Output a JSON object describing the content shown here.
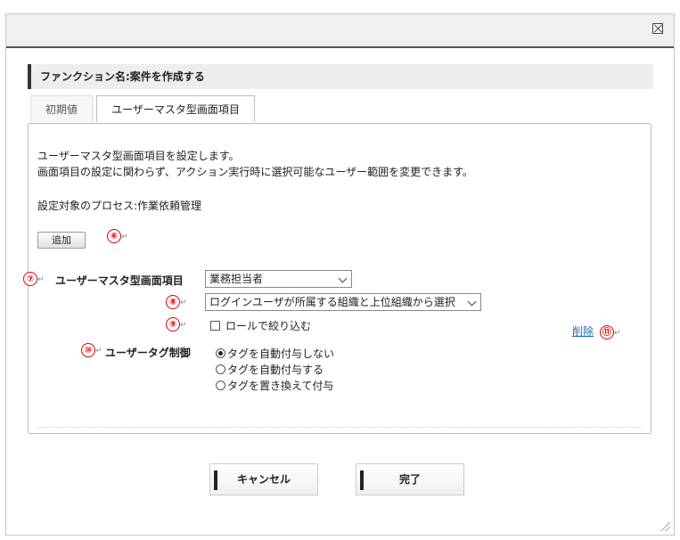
{
  "dialog": {
    "close_icon": "close-box-icon"
  },
  "function_header": "ファンクション名:案件を作成する",
  "tabs": [
    {
      "label": "初期値",
      "active": false
    },
    {
      "label": "ユーザーマスタ型画面項目",
      "active": true
    }
  ],
  "panel": {
    "description_line1": "ユーザーマスタ型画面項目を設定します。",
    "description_line2": "画面項目の設定に関わらず、アクション実行時に選択可能なユーザー範囲を変更できます。",
    "process_text": "設定対象のプロセス:作業依頼管理",
    "add_button": "追加",
    "field_label": "ユーザーマスタ型画面項目",
    "field_select_value": "業務担当者",
    "range_select_value": "ログインユーザが所属する組織と上位組織から選択",
    "role_checkbox_label": "ロールで絞り込む",
    "role_checked": false,
    "delete_link": "削除",
    "tag_control_label": "ユーザータグ制御",
    "tag_options": [
      {
        "label": "タグを自動付与しない",
        "selected": true
      },
      {
        "label": "タグを自動付与する",
        "selected": false
      },
      {
        "label": "タグを置き換えて付与",
        "selected": false
      }
    ]
  },
  "annotations": {
    "n6": "⑥",
    "n7": "⑦",
    "n8": "⑧",
    "n9": "⑨",
    "n10": "⑩",
    "n11": "⑪",
    "return_mark": "↵"
  },
  "footer": {
    "cancel_label": "キャンセル",
    "done_label": "完了"
  },
  "colors": {
    "annotation": "#d00000",
    "link": "#1a6fc0",
    "header_bg": "#eeeeee"
  }
}
